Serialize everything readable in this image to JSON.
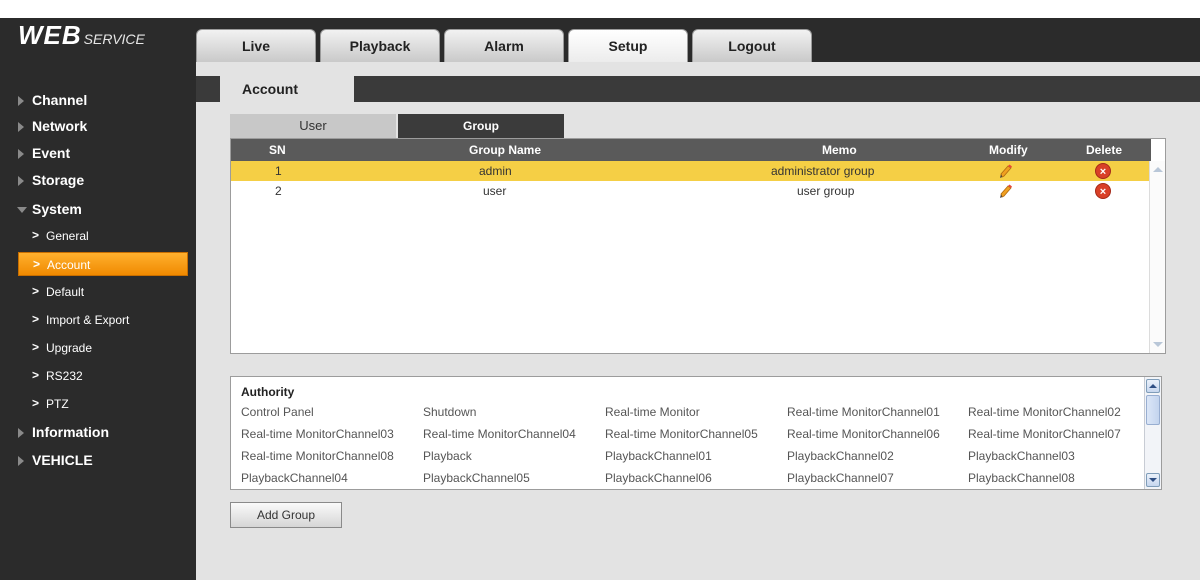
{
  "logo": {
    "web": "WEB",
    "service": "SERVICE"
  },
  "nav": {
    "tabs": [
      "Live",
      "Playback",
      "Alarm",
      "Setup",
      "Logout"
    ],
    "active": "Setup"
  },
  "sidebar": {
    "sections": [
      "Channel",
      "Network",
      "Event",
      "Storage",
      "System",
      "Information",
      "VEHICLE"
    ],
    "expanded": "System",
    "system_items": [
      "General",
      "Account",
      "Default",
      "Import & Export",
      "Upgrade",
      "RS232",
      "PTZ"
    ],
    "active_item": "Account"
  },
  "content": {
    "tab": "Account",
    "subtabs": {
      "user": "User",
      "group": "Group"
    },
    "active_subtab": "Group",
    "table": {
      "headers": {
        "sn": "SN",
        "group_name": "Group Name",
        "memo": "Memo",
        "modify": "Modify",
        "delete": "Delete"
      },
      "rows": [
        {
          "sn": "1",
          "group_name": "admin",
          "memo": "administrator group"
        },
        {
          "sn": "2",
          "group_name": "user",
          "memo": "user group"
        }
      ],
      "selected_row": 0
    },
    "authority": {
      "title": "Authority",
      "items": [
        "Control Panel",
        "Shutdown",
        "Real-time Monitor",
        "Real-time MonitorChannel01",
        "Real-time MonitorChannel02",
        "Real-time MonitorChannel03",
        "Real-time MonitorChannel04",
        "Real-time MonitorChannel05",
        "Real-time MonitorChannel06",
        "Real-time MonitorChannel07",
        "Real-time MonitorChannel08",
        "Playback",
        "PlaybackChannel01",
        "PlaybackChannel02",
        "PlaybackChannel03",
        "PlaybackChannel04",
        "PlaybackChannel05",
        "PlaybackChannel06",
        "PlaybackChannel07",
        "PlaybackChannel08"
      ]
    },
    "add_group_label": "Add Group"
  },
  "colors": {
    "selected_row": "#f5cf45",
    "active_side_item": "#f7a21b",
    "header_bg": "#2b2b2b",
    "content_bg": "#e3e3e3"
  },
  "icons": {
    "modify": "pencil-icon",
    "delete": "delete-icon"
  }
}
